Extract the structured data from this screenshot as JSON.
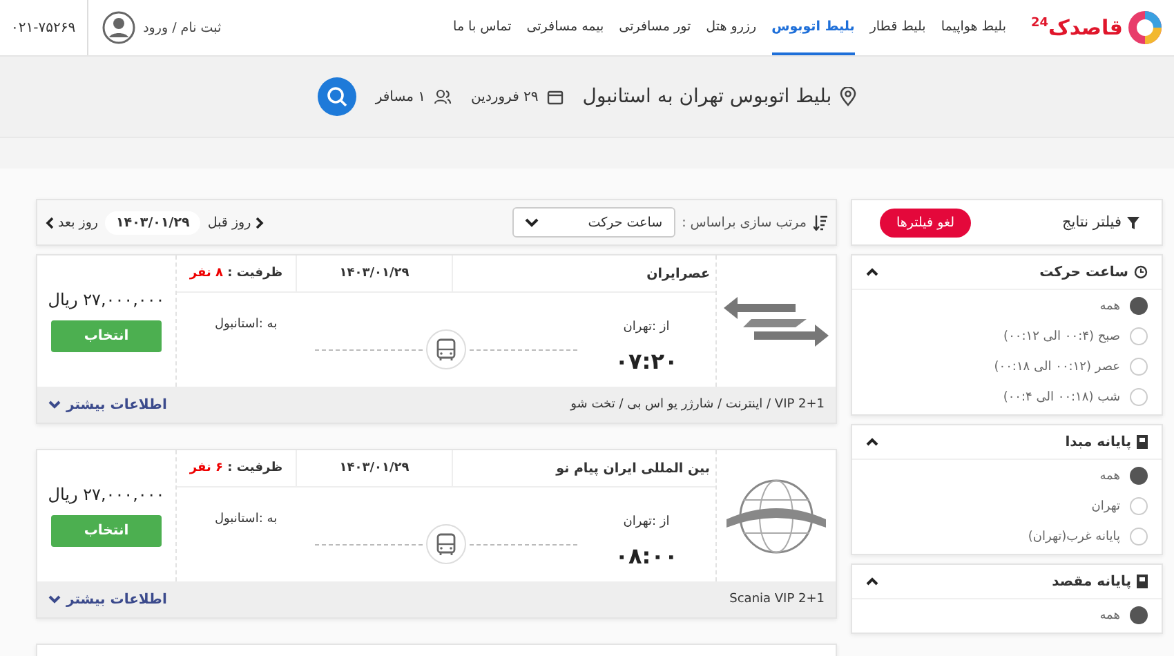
{
  "header": {
    "logo": {
      "text": "قاصدک",
      "badge": "24"
    },
    "nav": [
      {
        "label": "بلیط هواپیما",
        "selected": false
      },
      {
        "label": "بلیط قطار",
        "selected": false
      },
      {
        "label": "بلیط اتوبوس",
        "selected": true
      },
      {
        "label": "رزرو هتل",
        "selected": false
      },
      {
        "label": "تور مسافرتی",
        "selected": false
      },
      {
        "label": "بیمه مسافرتی",
        "selected": false
      },
      {
        "label": "تماس با ما",
        "selected": false
      }
    ],
    "login": "ثبت نام / ورود",
    "phone": "۰۲۱-۷۵۲۶۹"
  },
  "search": {
    "title": "بلیط اتوبوس تهران به استانبول",
    "date": "۲۹ فروردین",
    "passengers": "۱ مسافر"
  },
  "sort": {
    "label": "مرتب سازی براساس :",
    "value": "ساعت حرکت"
  },
  "day_nav": {
    "previous": "روز قبل",
    "date": "۱۴۰۳/۰۱/۲۹",
    "next": "روز بعد"
  },
  "results": [
    {
      "company": "عصرایران",
      "date": "۱۴۰۳/۰۱/۲۹",
      "capacity_label": "ظرفیت :",
      "capacity": "۸ نفر",
      "from": "از :تهران",
      "to": "به :استانبول",
      "time": "۰۷:۲۰",
      "price": "۲۷,۰۰۰,۰۰۰ ریال",
      "select": "انتخاب",
      "features": "VIP 2+1 / اینترنت / شارژر یو اس بی / تخت شو",
      "more": "اطلاعات بیشتر"
    },
    {
      "company": "بین المللی ایران پیام نو",
      "date": "۱۴۰۳/۰۱/۲۹",
      "capacity_label": "ظرفیت :",
      "capacity": "۶ نفر",
      "from": "از :تهران",
      "to": "به :استانبول",
      "time": "۰۸:۰۰",
      "price": "۲۷,۰۰۰,۰۰۰ ریال",
      "select": "انتخاب",
      "features": "Scania VIP 2+1",
      "more": "اطلاعات بیشتر"
    }
  ],
  "filters": {
    "title": "فیلتر نتایج",
    "clear": "لغو فیلترها",
    "sections": [
      {
        "title": "ساعت حرکت",
        "expanded": true,
        "options": [
          {
            "label": "همه",
            "selected": true
          },
          {
            "label": "صبح (۰۰:۴ الی ۰۰:۱۲)",
            "selected": false
          },
          {
            "label": "عصر (۰۰:۱۲ الی ۰۰:۱۸)",
            "selected": false
          },
          {
            "label": "شب (۰۰:۱۸ الی ۰۰:۴)",
            "selected": false
          }
        ]
      },
      {
        "title": "پایانه مبدا",
        "expanded": true,
        "options": [
          {
            "label": "همه",
            "selected": true
          },
          {
            "label": "تهران",
            "selected": false
          },
          {
            "label": "پایانه غرب(تهران)",
            "selected": false
          }
        ]
      },
      {
        "title": "پایانه مقصد",
        "expanded": true,
        "options": [
          {
            "label": "همه",
            "selected": true
          }
        ]
      }
    ]
  }
}
